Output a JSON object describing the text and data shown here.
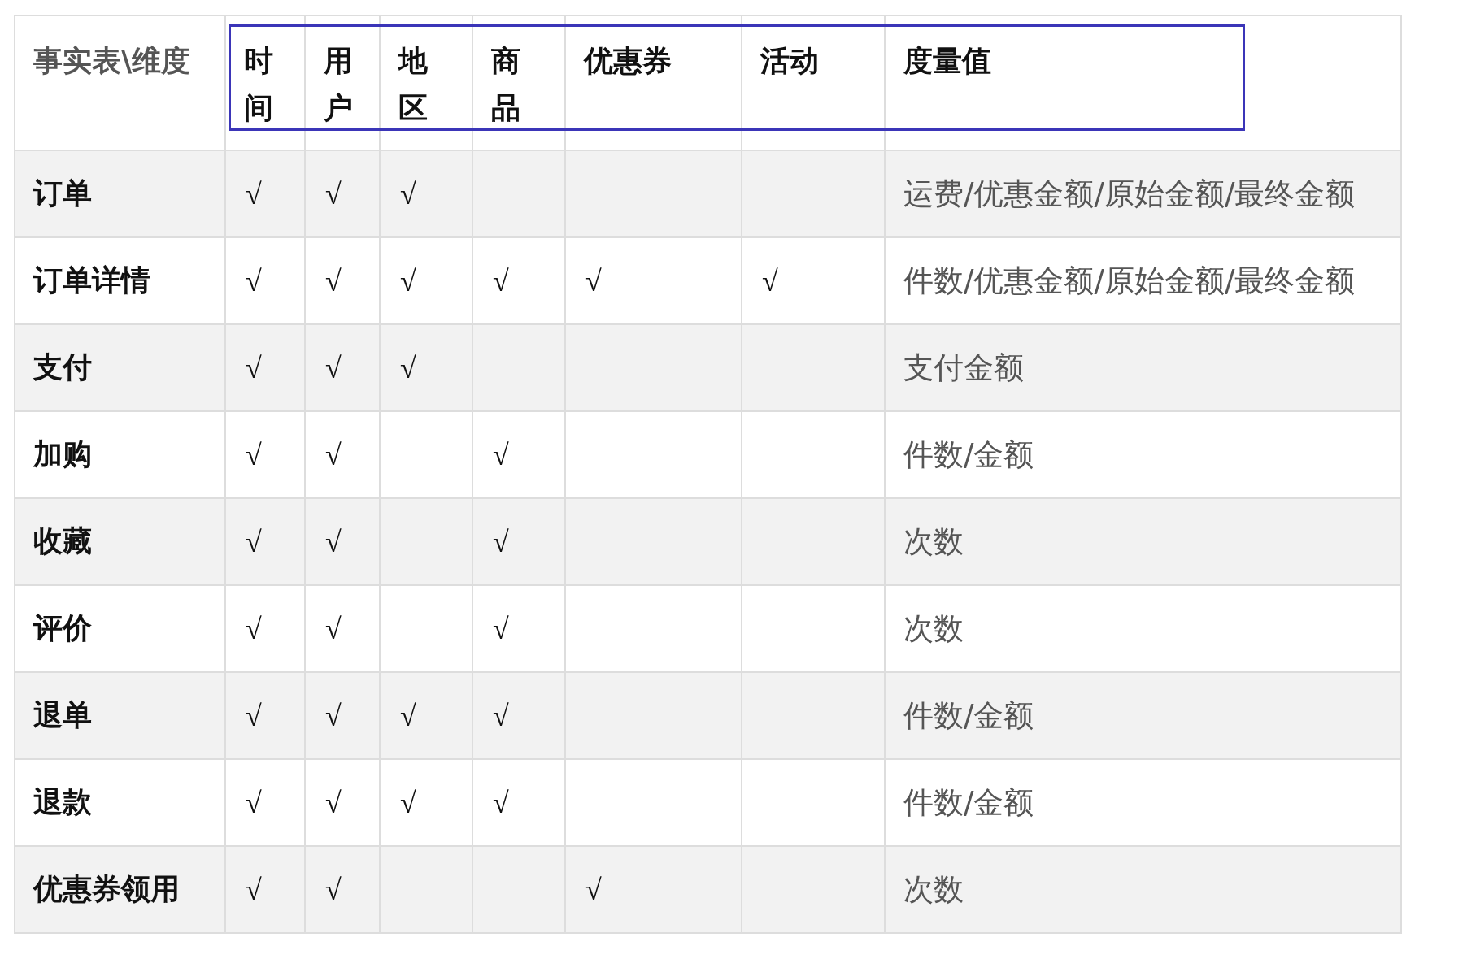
{
  "table": {
    "columns": [
      "事实表\\维度",
      "时间",
      "用户",
      "地区",
      "商品",
      "优惠券",
      "活动",
      "度量值"
    ],
    "rows": [
      [
        "订单",
        "√",
        "√",
        "√",
        "",
        "",
        "",
        "运费/优惠金额/原始金额/最终金额"
      ],
      [
        "订单详情",
        "√",
        "√",
        "√",
        "√",
        "√",
        "√",
        "件数/优惠金额/原始金额/最终金额"
      ],
      [
        "支付",
        "√",
        "√",
        "√",
        "",
        "",
        "",
        "支付金额"
      ],
      [
        "加购",
        "√",
        "√",
        "",
        "√",
        "",
        "",
        "件数/金额"
      ],
      [
        "收藏",
        "√",
        "√",
        "",
        "√",
        "",
        "",
        "次数"
      ],
      [
        "评价",
        "√",
        "√",
        "",
        "√",
        "",
        "",
        "次数"
      ],
      [
        "退单",
        "√",
        "√",
        "√",
        "√",
        "",
        "",
        "件数/金额"
      ],
      [
        "退款",
        "√",
        "√",
        "√",
        "√",
        "",
        "",
        "件数/金额"
      ],
      [
        "优惠券领用",
        "√",
        "√",
        "",
        "",
        "√",
        "",
        "次数"
      ]
    ]
  }
}
